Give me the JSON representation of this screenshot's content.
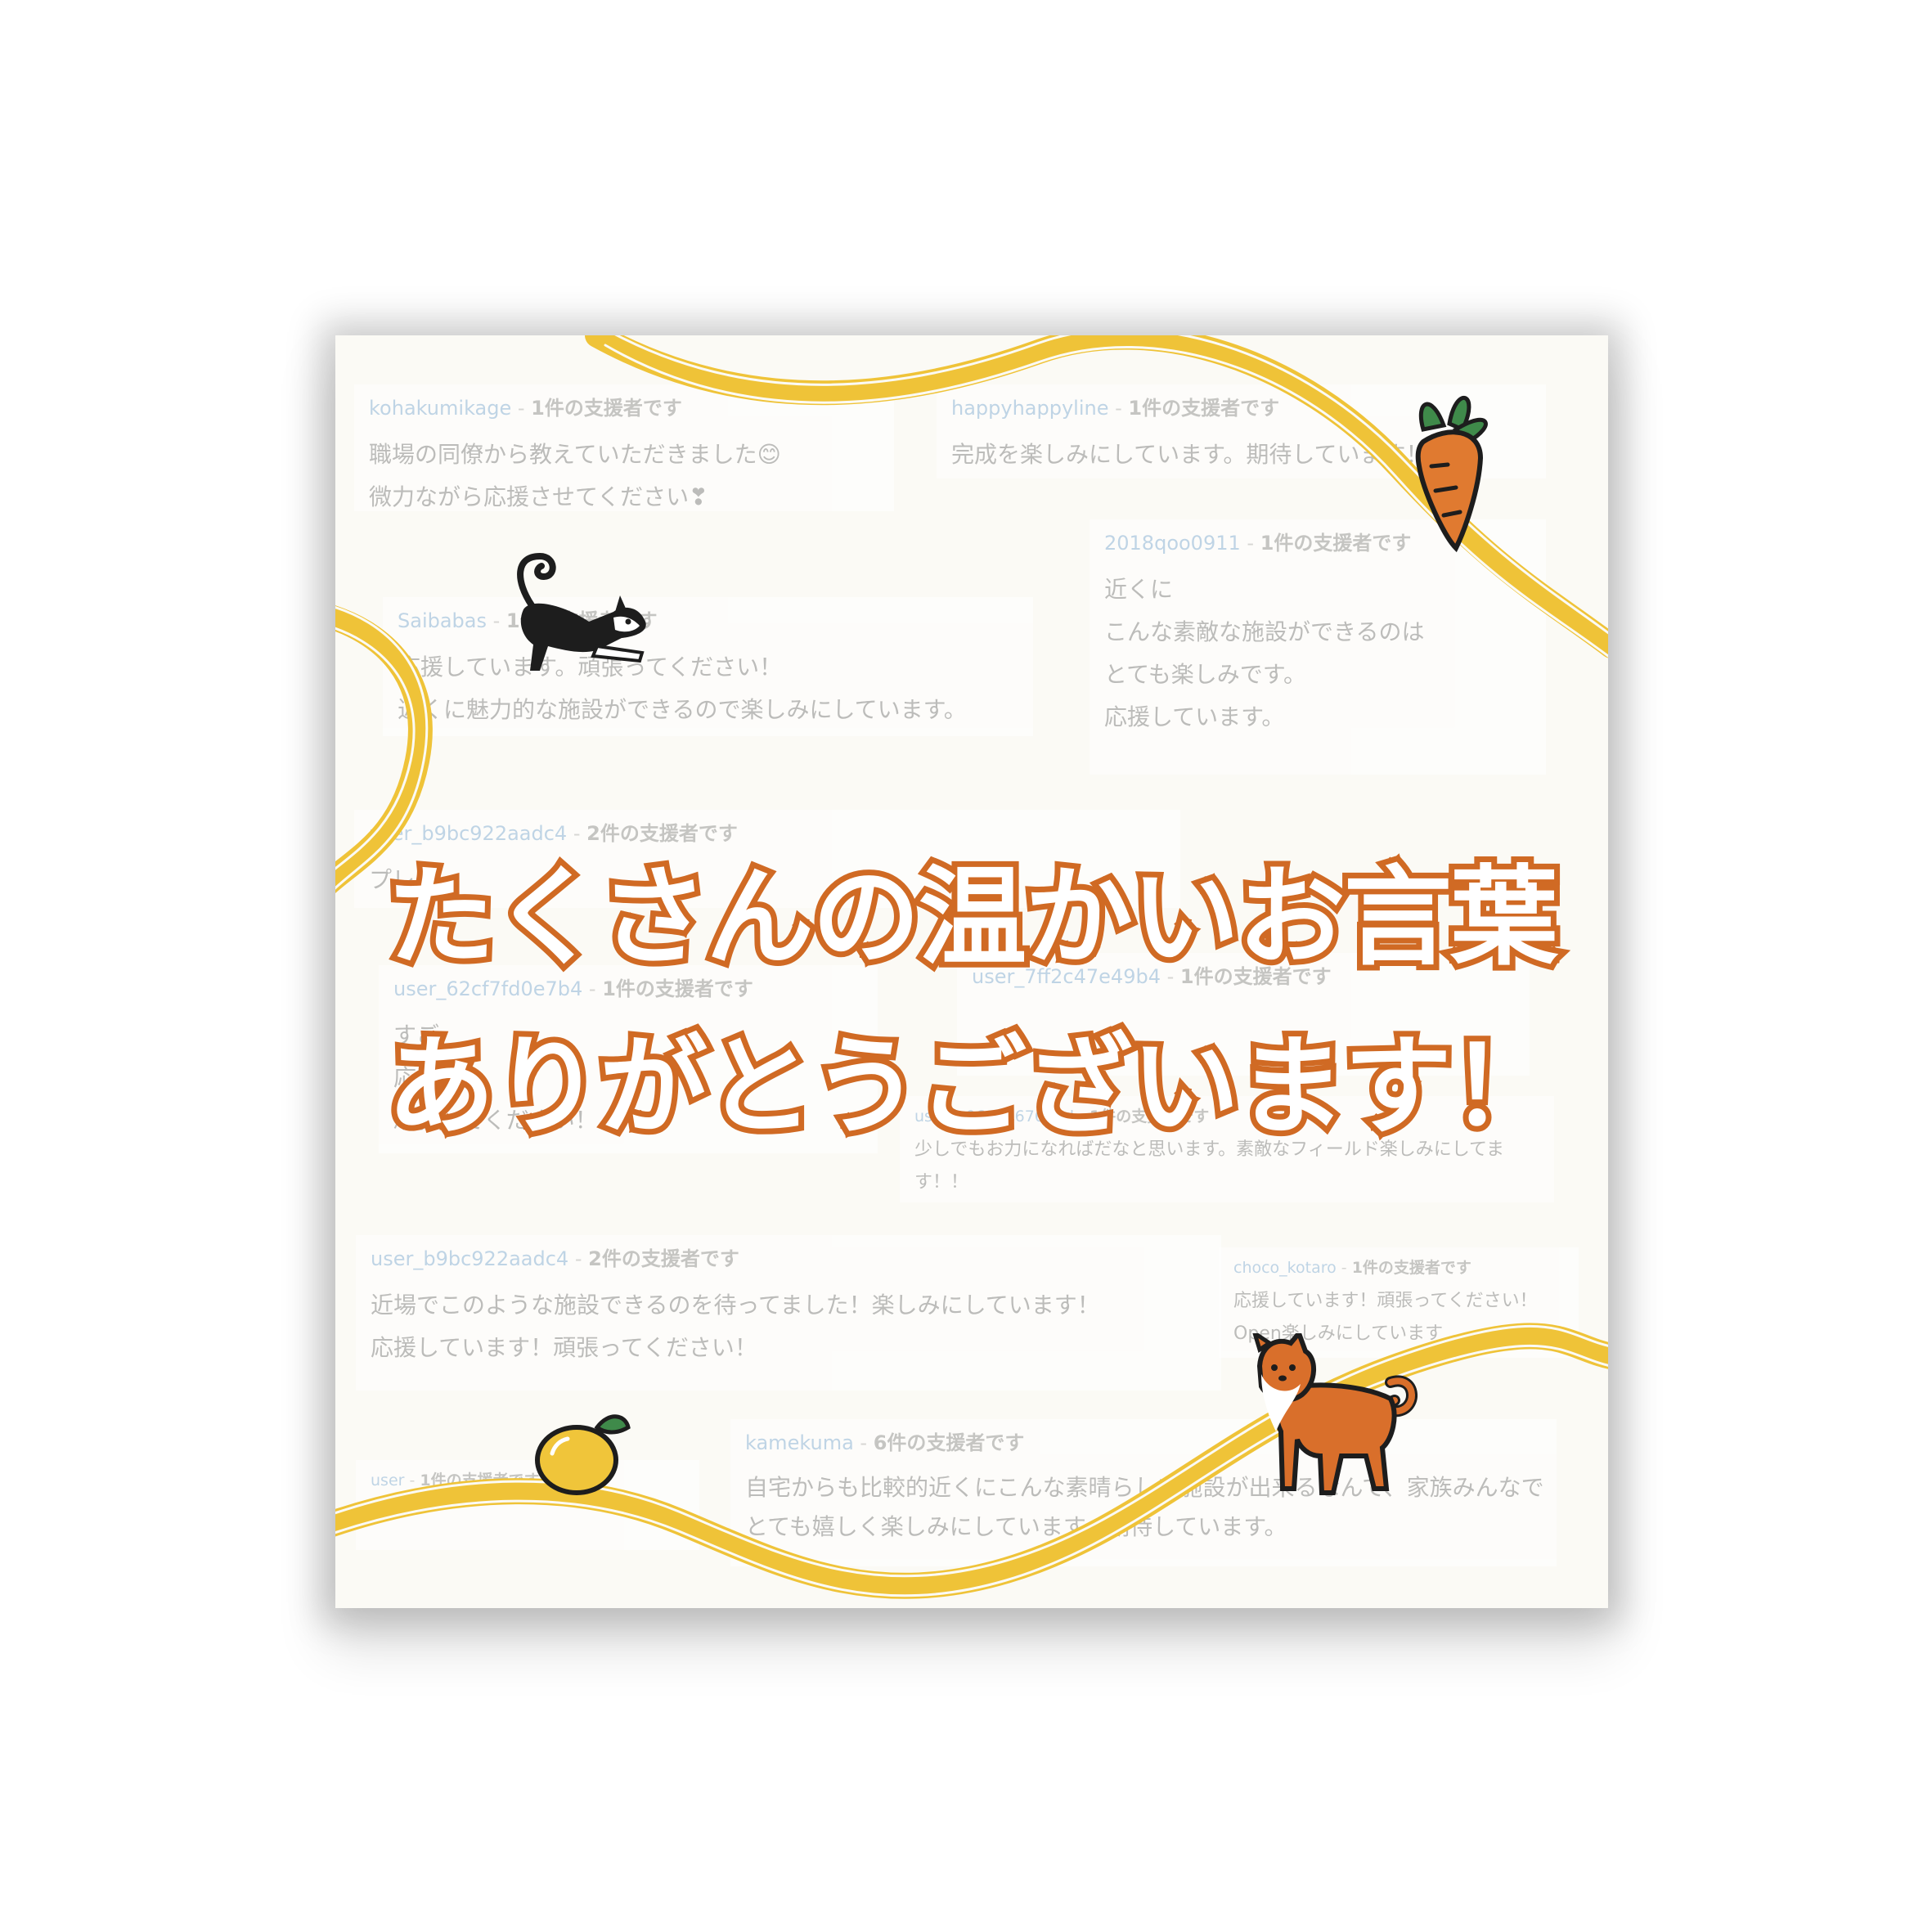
{
  "headline": {
    "line1": "たくさんの温かいお言葉",
    "line2": "ありがとうございます！"
  },
  "comments": [
    {
      "user": "kohakumikage",
      "sep": " - ",
      "count": "1件の支援者です",
      "message": "職場の同僚から教えていただきました😊\n微力ながら応援させてください❣"
    },
    {
      "user": "happyhappyline",
      "sep": " - ",
      "count": "1件の支援者です",
      "message": "完成を楽しみにしています。期待しています！"
    },
    {
      "user": "2018qoo0911",
      "sep": " - ",
      "count": "1件の支援者です",
      "message": "近くに\nこんな素敵な施設ができるのは\nとても楽しみです。\n応援しています。"
    },
    {
      "user": "Saibabas",
      "sep": " - ",
      "count": "1件の支援者です",
      "message": "応援しています。頑張ってください！\n近くに魅力的な施設ができるので楽しみにしています。"
    },
    {
      "user": "user_b9bc922aadc4",
      "sep": " - ",
      "count": "2件の支援者です",
      "message": "プレー"
    },
    {
      "user": "user_62cf7fd0e7b4",
      "sep": " - ",
      "count": "1件の支援者です",
      "message": "すご\n応援\n頑張ってください！"
    },
    {
      "user": "user_7ff2c47e49b4",
      "sep": " - ",
      "count": "1件の支援者です",
      "message": ""
    },
    {
      "user": "user_e0611a676b8d",
      "sep": " - ",
      "count": "1件の支援者です",
      "message": "少しでもお力になればだなと思います。素敵なフィールド楽しみにしてます！！"
    },
    {
      "user": "user_b9bc922aadc4",
      "sep": " - ",
      "count": "2件の支援者です",
      "message": "近場でこのような施設できるのを待ってました！楽しみにしています！\n応援しています！頑張ってください！"
    },
    {
      "user": "choco_kotaro",
      "sep": " - ",
      "count": "1件の支援者です",
      "message": "応援しています！頑張ってください！\nOpen楽しみにしています"
    },
    {
      "user": "kamekuma",
      "sep": " - ",
      "count": "6件の支援者です",
      "message": "自宅からも比較的近くにこんな素晴らしい施設が出来るなんて、家族みんなでとても嬉しく楽しみにしています。期待しています。"
    },
    {
      "user": "user",
      "sep": " - ",
      "count": "1件の支援者です",
      "message": ""
    }
  ],
  "colors": {
    "background": "#fbfaf5",
    "ribbon": "#efc338",
    "headline_outline": "#d06a24",
    "username": "#8fb6d9"
  },
  "stickers": [
    "black-shiba-dog-icon",
    "carrot-icon",
    "lemon-icon",
    "orange-shiba-dog-icon"
  ]
}
